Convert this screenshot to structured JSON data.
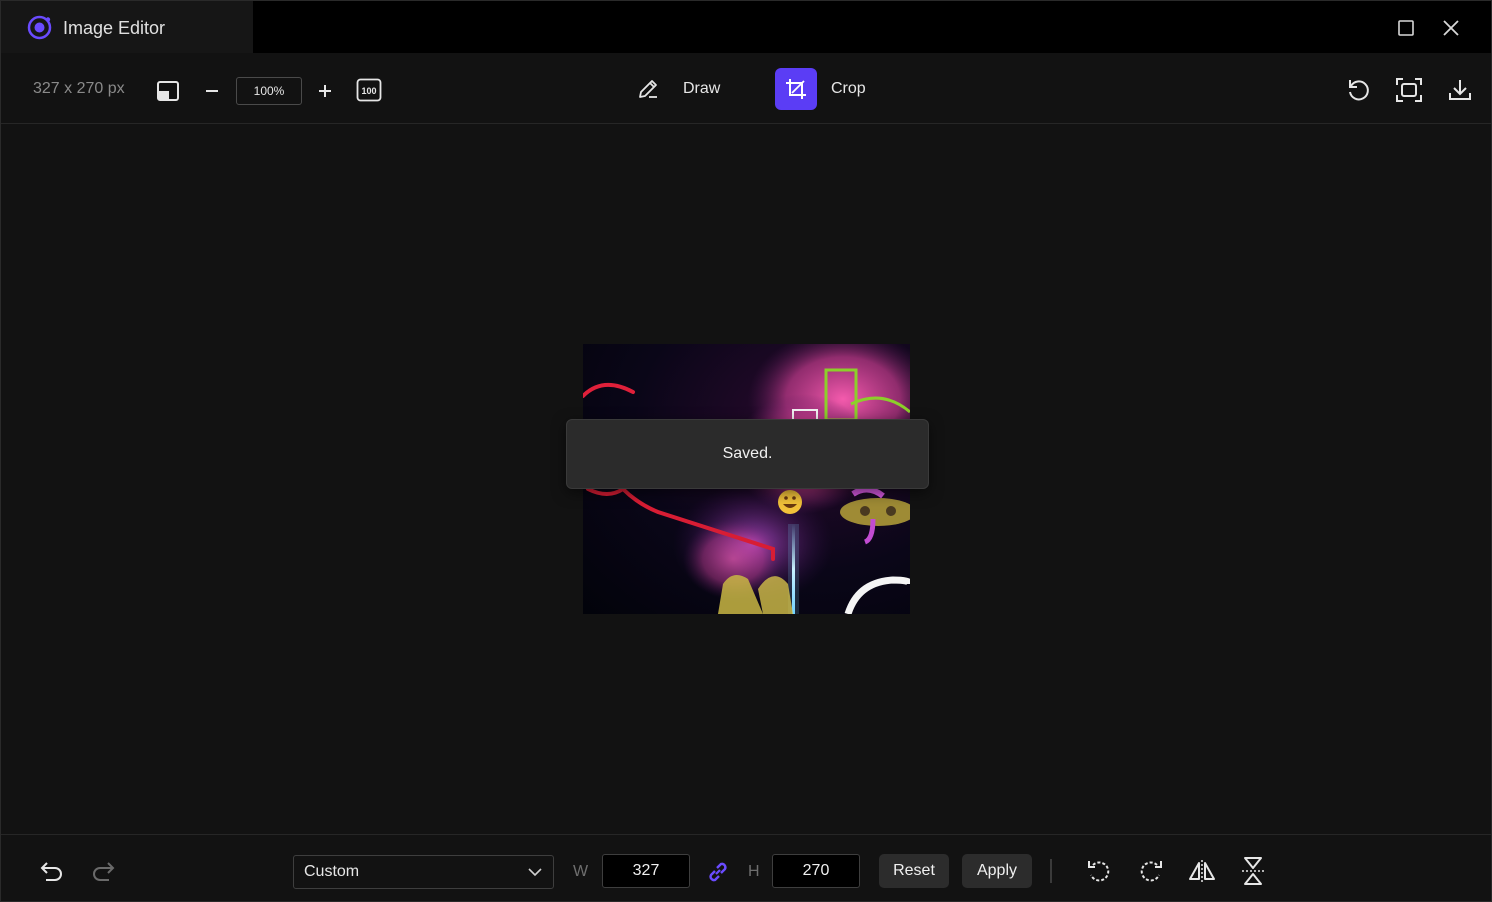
{
  "window": {
    "title": "Image Editor",
    "accent_color": "#5b3df5"
  },
  "toolbar": {
    "dimensions": "327 x 270 px",
    "zoom": "100%",
    "modes": [
      {
        "label": "Draw",
        "icon": "pencil-icon",
        "active": false
      },
      {
        "label": "Crop",
        "icon": "crop-icon",
        "active": true
      }
    ]
  },
  "toast": {
    "message": "Saved."
  },
  "crop": {
    "preset": "Custom",
    "width_label": "W",
    "width_value": "327",
    "height_label": "H",
    "height_value": "270",
    "reset_label": "Reset",
    "apply_label": "Apply"
  }
}
